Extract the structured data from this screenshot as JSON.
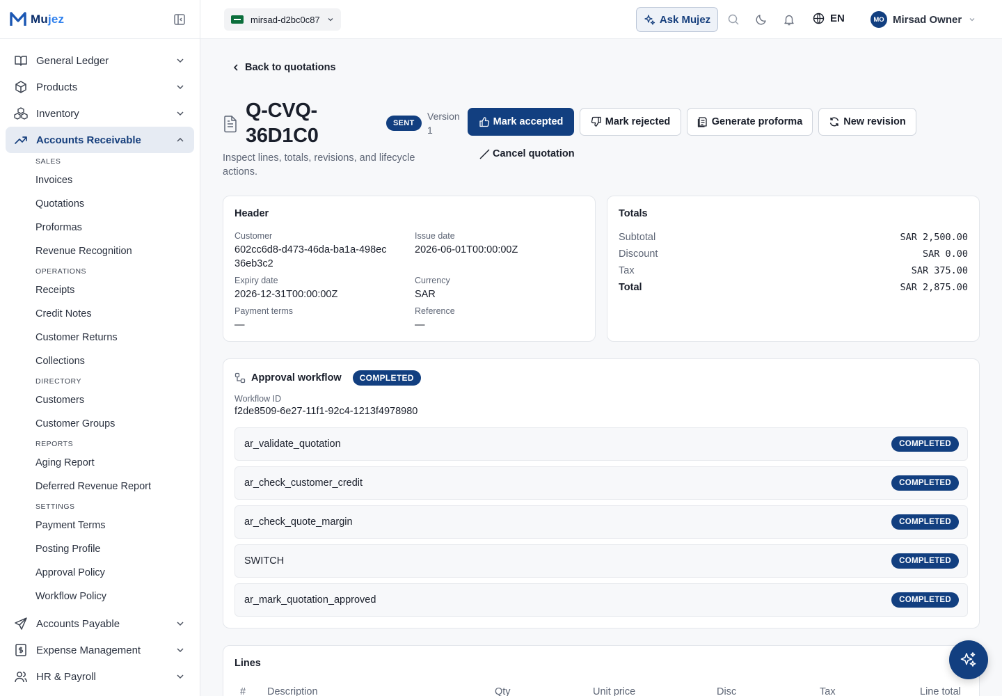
{
  "brand": {
    "name_part1": "Mu",
    "name_part2": "jez"
  },
  "topbar": {
    "org": "mirsad-d2bc0c87",
    "ask_label": "Ask Mujez",
    "language": "EN",
    "user_initials": "MO",
    "user_name": "Mirsad Owner"
  },
  "sidebar": {
    "top_items": [
      {
        "label": "General Ledger",
        "icon": "book-icon"
      },
      {
        "label": "Products",
        "icon": "box-icon"
      },
      {
        "label": "Inventory",
        "icon": "boxes-icon"
      },
      {
        "label": "Accounts Receivable",
        "icon": "trending-up-icon"
      }
    ],
    "sections": {
      "sales": "SALES",
      "operations": "OPERATIONS",
      "directory": "DIRECTORY",
      "reports": "REPORTS",
      "settings": "SETTINGS"
    },
    "sales_links": [
      "Invoices",
      "Quotations",
      "Proformas",
      "Revenue Recognition"
    ],
    "operations_links": [
      "Receipts",
      "Credit Notes",
      "Customer Returns",
      "Collections"
    ],
    "directory_links": [
      "Customers",
      "Customer Groups"
    ],
    "reports_links": [
      "Aging Report",
      "Deferred Revenue Report"
    ],
    "settings_links": [
      "Payment Terms",
      "Posting Profile",
      "Approval Policy",
      "Workflow Policy"
    ],
    "bottom_items": [
      {
        "label": "Accounts Payable",
        "icon": "send-icon"
      },
      {
        "label": "Expense Management",
        "icon": "receipt-dollar-icon"
      },
      {
        "label": "HR & Payroll",
        "icon": "users-icon"
      }
    ]
  },
  "page": {
    "back_label": "Back to quotations",
    "title": "Q-CVQ-36D1C0",
    "status": "SENT",
    "version_label": "Version",
    "version_number": "1",
    "subtitle": "Inspect lines, totals, revisions, and lifecycle actions.",
    "actions": {
      "accept": "Mark accepted",
      "reject": "Mark rejected",
      "proforma": "Generate proforma",
      "revision": "New revision",
      "cancel": "Cancel quotation"
    }
  },
  "header_card": {
    "title": "Header",
    "customer_label": "Customer",
    "customer": "602cc6d8-d473-46da-ba1a-498ec36eb3c2",
    "issue_date_label": "Issue date",
    "issue_date": "2026-06-01T00:00:00Z",
    "expiry_date_label": "Expiry date",
    "expiry_date": "2026-12-31T00:00:00Z",
    "currency_label": "Currency",
    "currency": "SAR",
    "payment_terms_label": "Payment terms",
    "payment_terms": "—",
    "reference_label": "Reference",
    "reference": "—"
  },
  "totals_card": {
    "title": "Totals",
    "rows": [
      {
        "label": "Subtotal",
        "value": "SAR 2,500.00"
      },
      {
        "label": "Discount",
        "value": "SAR 0.00"
      },
      {
        "label": "Tax",
        "value": "SAR 375.00"
      },
      {
        "label": "Total",
        "value": "SAR 2,875.00"
      }
    ]
  },
  "workflow": {
    "title": "Approval workflow",
    "status": "COMPLETED",
    "id_label": "Workflow ID",
    "id": "f2de8509-6e27-11f1-92c4-1213f4978980",
    "steps": [
      {
        "name": "ar_validate_quotation",
        "status": "COMPLETED"
      },
      {
        "name": "ar_check_customer_credit",
        "status": "COMPLETED"
      },
      {
        "name": "ar_check_quote_margin",
        "status": "COMPLETED"
      },
      {
        "name": "SWITCH",
        "status": "COMPLETED"
      },
      {
        "name": "ar_mark_quotation_approved",
        "status": "COMPLETED"
      }
    ]
  },
  "lines": {
    "title": "Lines",
    "columns": [
      "#",
      "Description",
      "Qty",
      "Unit price",
      "Disc",
      "Tax",
      "Line total"
    ]
  },
  "colors": {
    "primary": "#123f80",
    "brand": "#0b2e6b",
    "accent": "#2f80ed"
  }
}
